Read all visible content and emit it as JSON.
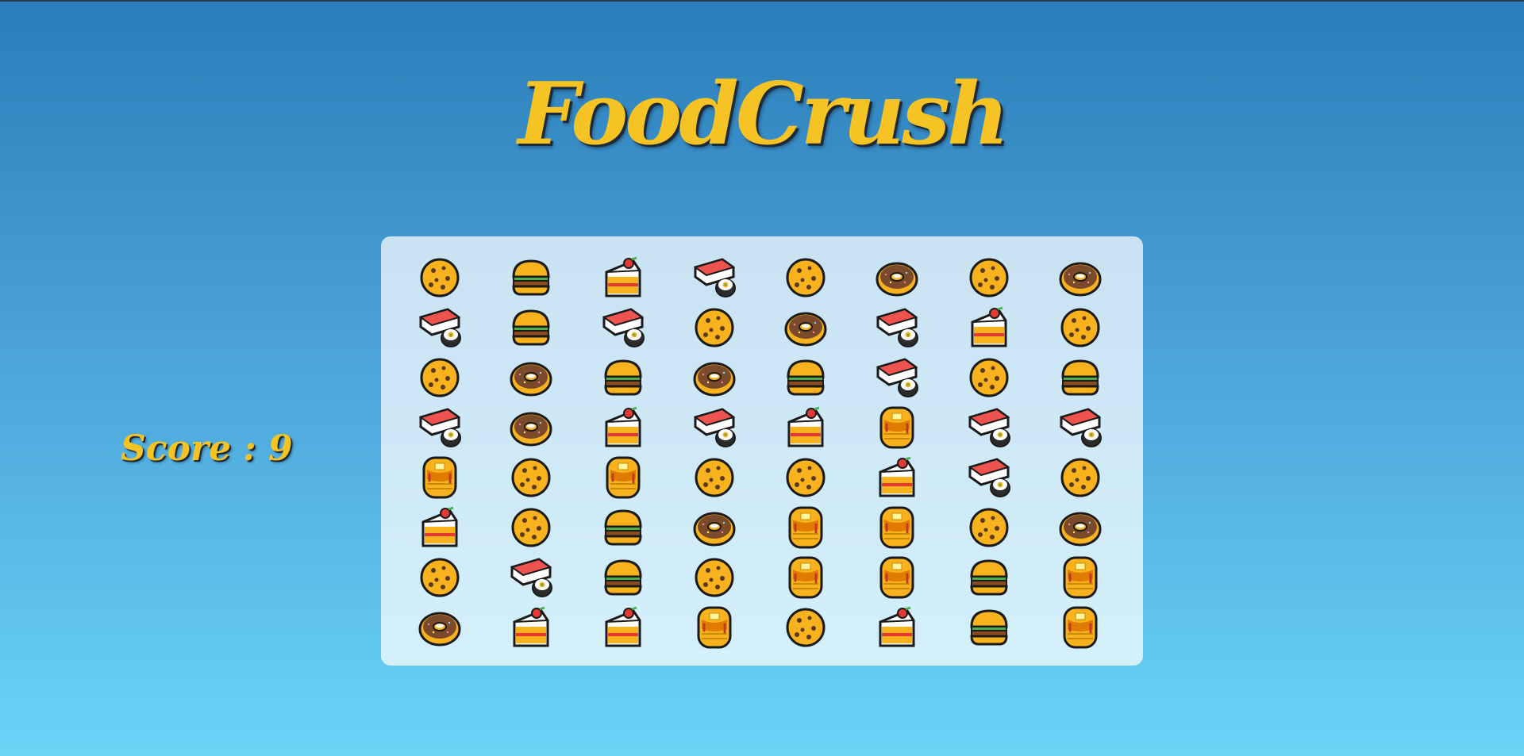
{
  "title": "FoodCrush",
  "score_text": "Score : 9",
  "colors": {
    "title": "#f6c324",
    "board_bg": "rgba(255,255,255,0.72)"
  },
  "grid": [
    [
      "cookie",
      "burger",
      "cake",
      "sushi",
      "cookie",
      "donut",
      "cookie",
      "donut"
    ],
    [
      "sushi",
      "burger",
      "sushi",
      "cookie",
      "donut",
      "sushi",
      "cake",
      "cookie"
    ],
    [
      "cookie",
      "donut",
      "burger",
      "donut",
      "burger",
      "sushi",
      "cookie",
      "burger"
    ],
    [
      "sushi",
      "donut",
      "cake",
      "sushi",
      "cake",
      "pancakes",
      "sushi",
      "sushi"
    ],
    [
      "pancakes",
      "cookie",
      "pancakes",
      "cookie",
      "cookie",
      "cake",
      "sushi",
      "cookie"
    ],
    [
      "cake",
      "cookie",
      "burger",
      "donut",
      "pancakes",
      "pancakes",
      "cookie",
      "donut"
    ],
    [
      "cookie",
      "sushi",
      "burger",
      "cookie",
      "pancakes",
      "pancakes",
      "burger",
      "pancakes"
    ],
    [
      "donut",
      "cake",
      "cake",
      "pancakes",
      "cookie",
      "cake",
      "burger",
      "pancakes"
    ]
  ]
}
